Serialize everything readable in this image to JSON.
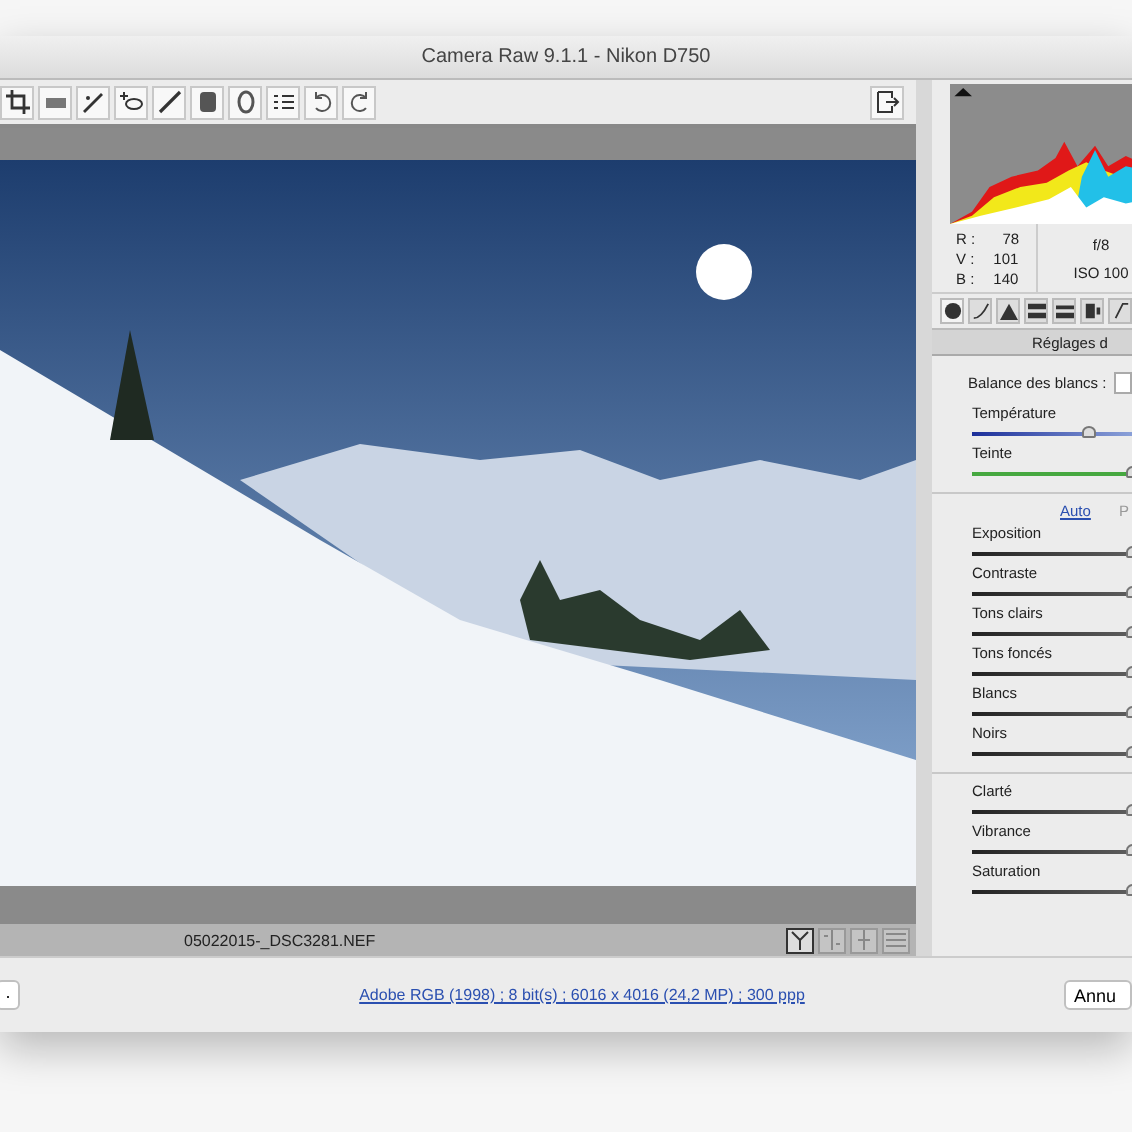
{
  "window": {
    "title": "Camera Raw 9.1.1  -  Nikon D750"
  },
  "image": {
    "filename": "05022015-_DSC3281.NEF"
  },
  "readout": {
    "rgb": [
      {
        "label": "R :",
        "value": "78"
      },
      {
        "label": "V :",
        "value": "101"
      },
      {
        "label": "B :",
        "value": "140"
      }
    ],
    "aperture": "f/8",
    "iso": "ISO 100"
  },
  "panel": {
    "title": "Réglages d",
    "balance_label": "Balance des blancs :",
    "groups": [
      {
        "sliders": [
          {
            "name": "Température",
            "kind": "temperature",
            "level": 0.36
          },
          {
            "name": "Teinte",
            "kind": "tint",
            "level": 0.5
          }
        ]
      },
      {
        "links": [
          "Auto",
          "P"
        ],
        "sliders": [
          {
            "name": "Exposition",
            "kind": "plain",
            "level": 0.5
          },
          {
            "name": "Contraste",
            "kind": "plain",
            "level": 0.5
          },
          {
            "name": "Tons clairs",
            "kind": "plain",
            "level": 0.5
          },
          {
            "name": "Tons foncés",
            "kind": "plain",
            "level": 0.5
          },
          {
            "name": "Blancs",
            "kind": "plain",
            "level": 0.5
          },
          {
            "name": "Noirs",
            "kind": "plain",
            "level": 0.5
          }
        ]
      },
      {
        "sliders": [
          {
            "name": "Clarté",
            "kind": "plain",
            "level": 0.5
          },
          {
            "name": "Vibrance",
            "kind": "plain",
            "level": 0.5
          },
          {
            "name": "Saturation",
            "kind": "plain",
            "level": 0.5
          }
        ]
      }
    ]
  },
  "footer": {
    "left_button": ".",
    "workflow_link": "Adobe RGB (1998) ; 8 bit(s) ; 6016 x 4016 (24,2 MP) ; 300 ppp",
    "right_button": "Annu"
  }
}
